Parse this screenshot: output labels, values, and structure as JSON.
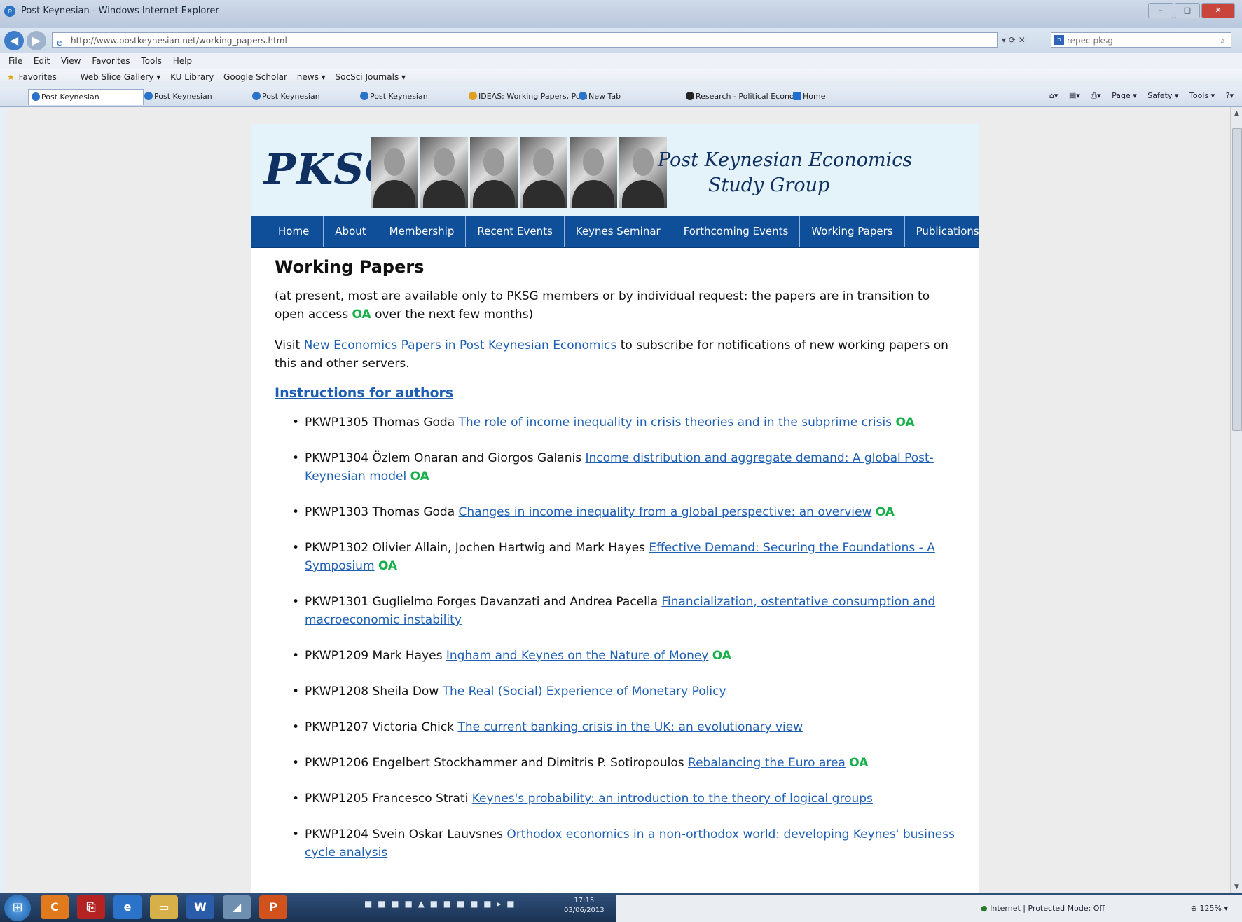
{
  "browser": {
    "window_title": "Post Keynesian - Windows Internet Explorer",
    "url": "http://www.postkeynesian.net/working_papers.html",
    "search_text": "repec pksg",
    "menu": [
      "File",
      "Edit",
      "View",
      "Favorites",
      "Tools",
      "Help"
    ],
    "favorites_label": "Favorites",
    "favorites_items": [
      "Web Slice Gallery ▾",
      "KU Library",
      "Google Scholar",
      "news ▾",
      "SocSci Journals ▾"
    ],
    "tabs": [
      "Post Keynesian",
      "Post Keynesian",
      "Post Keynesian",
      "Post Keynesian",
      "IDEAS: Working Papers, Po...",
      "New Tab",
      "Research - Political Econo...",
      "Home"
    ],
    "command_items": [
      "Page ▾",
      "Safety ▾",
      "Tools ▾"
    ],
    "status_zone": "Internet | Protected Mode: Off",
    "status_zoom": "125%",
    "clock_time": "17:15",
    "clock_date": "03/06/2013"
  },
  "site": {
    "logo": "PKSG",
    "title_line1": "Post Keynesian Economics",
    "title_line2": "Study Group",
    "nav": [
      "Home",
      "About",
      "Membership",
      "Recent Events",
      "Keynes Seminar",
      "Forthcoming Events",
      "Working Papers",
      "Publications"
    ]
  },
  "page": {
    "heading": "Working Papers",
    "intro_before_oa": "(at present, most are available only to PKSG members or by individual request: the papers are in transition to open access ",
    "oa": "OA",
    "intro_after_oa": " over the next few months)",
    "visit_prefix": "Visit ",
    "visit_link": "New Economics Papers in Post Keynesian Economics",
    "visit_suffix": " to subscribe for notifications of new working papers on this and other servers.",
    "instructions_link": "Instructions for authors",
    "papers": [
      {
        "id": "PKWP1305",
        "authors": "Thomas Goda",
        "title": "The role of income inequality in crisis theories and in the subprime crisis",
        "oa": "OA"
      },
      {
        "id": "PKWP1304",
        "authors": "Özlem Onaran and Giorgos Galanis",
        "title": "Income distribution and aggregate demand: A global Post-Keynesian model",
        "oa": "OA"
      },
      {
        "id": "PKWP1303",
        "authors": "Thomas Goda",
        "title": "Changes in income inequality from a global perspective: an overview",
        "oa": "OA"
      },
      {
        "id": "PKWP1302",
        "authors": "Olivier Allain, Jochen Hartwig and Mark Hayes",
        "title": "Effective Demand: Securing the Foundations - A Symposium",
        "oa": "OA"
      },
      {
        "id": "PKWP1301",
        "authors": "Guglielmo Forges Davanzati and Andrea Pacella",
        "title": "Financialization, ostentative consumption and macroeconomic instability",
        "oa": ""
      },
      {
        "id": "PKWP1209",
        "authors": "Mark Hayes",
        "title": "Ingham and Keynes on the Nature of Money",
        "oa": "OA"
      },
      {
        "id": "PKWP1208",
        "authors": "Sheila Dow",
        "title": "The Real (Social) Experience of Monetary Policy",
        "oa": ""
      },
      {
        "id": "PKWP1207",
        "authors": "Victoria Chick",
        "title": "The current banking crisis in the UK: an evolutionary view",
        "oa": ""
      },
      {
        "id": "PKWP1206",
        "authors": "Engelbert Stockhammer and Dimitris P. Sotiropoulos",
        "title": "Rebalancing the Euro area",
        "oa": "OA"
      },
      {
        "id": "PKWP1205",
        "authors": "Francesco Strati",
        "title": "Keynes's probability: an introduction to the theory of logical groups",
        "oa": ""
      },
      {
        "id": "PKWP1204",
        "authors": "Svein Oskar Lauvsnes",
        "title": "Orthodox economics in a non-orthodox world: developing Keynes' business cycle analysis",
        "oa": ""
      }
    ]
  }
}
